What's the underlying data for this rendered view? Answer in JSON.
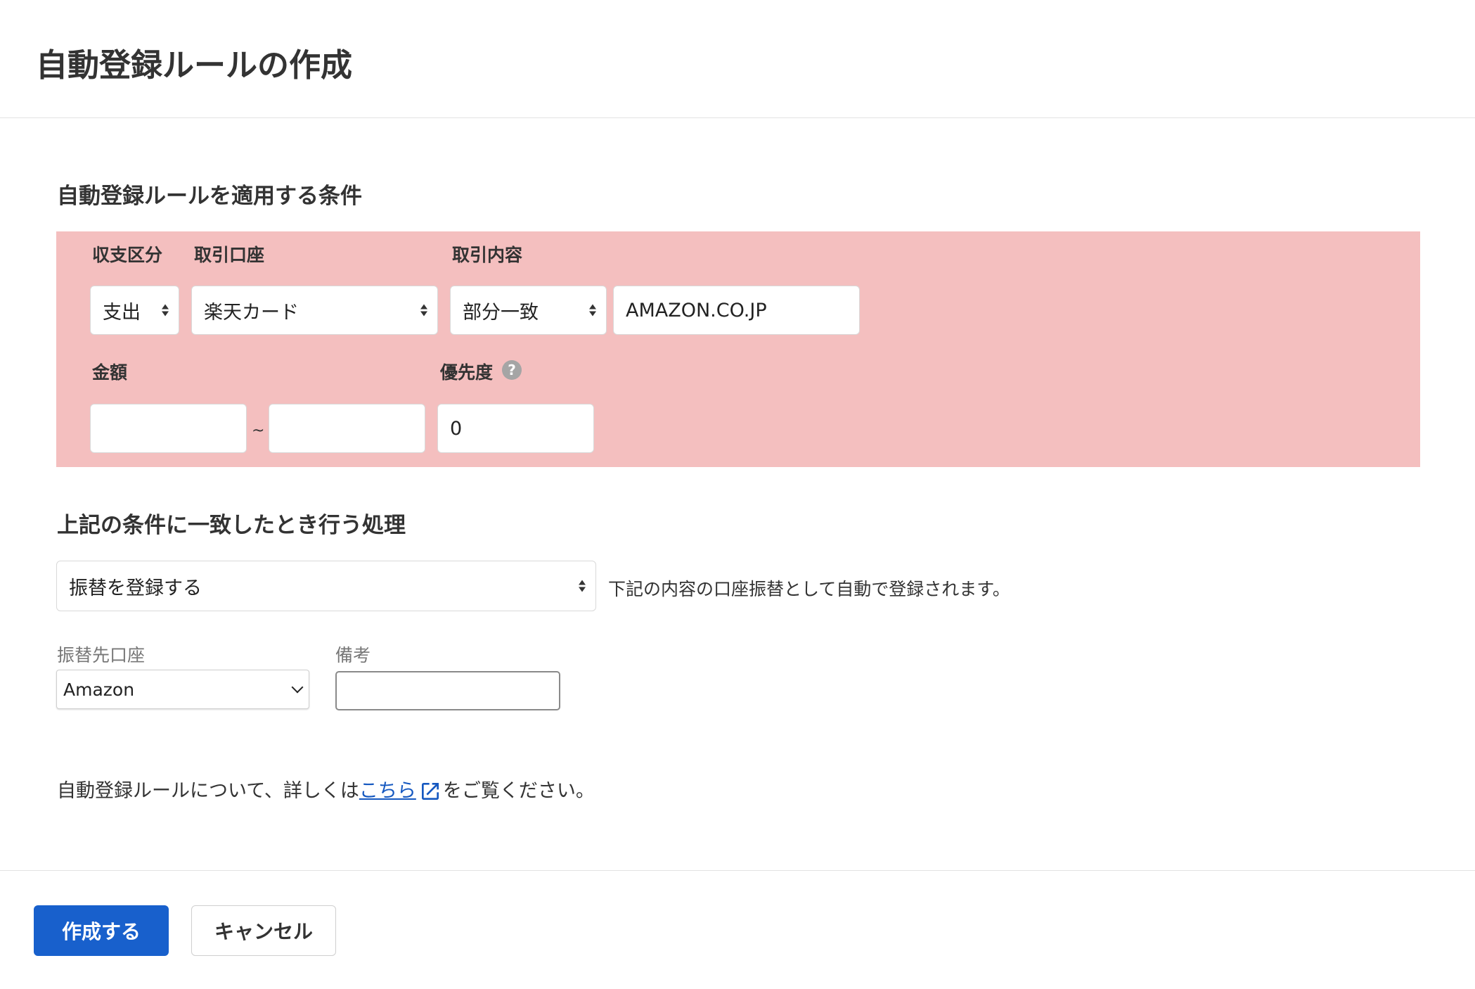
{
  "header": {
    "title": "自動登録ルールの作成"
  },
  "conditions": {
    "title": "自動登録ルールを適用する条件",
    "labels": {
      "income_expense": "収支区分",
      "account": "取引口座",
      "content": "取引内容",
      "amount": "金額",
      "priority": "優先度"
    },
    "income_expense_value": "支出",
    "account_value": "楽天カード",
    "match_type_value": "部分一致",
    "content_value": "AMAZON.CO.JP",
    "amount_min": "",
    "amount_max": "",
    "range_separator": "~",
    "priority_value": "0",
    "help_icon_glyph": "?"
  },
  "action": {
    "title": "上記の条件に一致したとき行う処理",
    "action_value": "振替を登録する",
    "hint": "下記の内容の口座振替として自動で登録されます。",
    "destination_label": "振替先口座",
    "destination_value": "Amazon",
    "memo_label": "備考",
    "memo_value": ""
  },
  "note": {
    "prefix": "自動登録ルールについて、詳しくは",
    "link": "こちら",
    "suffix": "をご覧ください。"
  },
  "footer": {
    "create_label": "作成する",
    "cancel_label": "キャンセル"
  },
  "colors": {
    "accent": "#1860cc",
    "condition_bg": "#f4bfbf",
    "link": "#1558c0"
  }
}
